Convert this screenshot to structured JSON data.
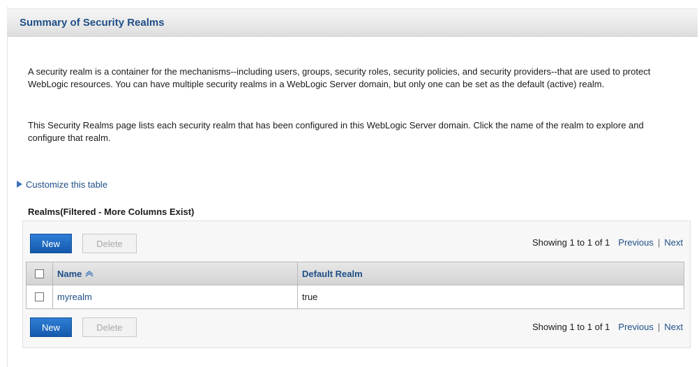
{
  "page": {
    "title": "Summary of Security Realms",
    "description_1": "A security realm is a container for the mechanisms--including users, groups, security roles, security policies, and security providers--that are used to protect WebLogic resources. You can have multiple security realms in a WebLogic Server domain, but only one can be set as the default (active) realm.",
    "description_2": "This Security Realms page lists each security realm that has been configured in this WebLogic Server domain. Click the name of the realm to explore and configure that realm."
  },
  "customize": {
    "label": "Customize this table",
    "icon": "expand-triangle-icon"
  },
  "table": {
    "caption": "Realms(Filtered - More Columns Exist)",
    "toolbar": {
      "new_label": "New",
      "delete_label": "Delete",
      "showing": "Showing 1 to 1 of 1",
      "previous": "Previous",
      "separator": "|",
      "next": "Next"
    },
    "columns": [
      "Name",
      "Default Realm"
    ],
    "sort_icon": "sort-ascending-icon",
    "rows": [
      {
        "name": "myrealm",
        "default_realm": "true"
      }
    ]
  },
  "colors": {
    "accent": "#1e4f87",
    "button_primary": "#1a6ac4",
    "panel_bg": "#f7f7f7"
  }
}
